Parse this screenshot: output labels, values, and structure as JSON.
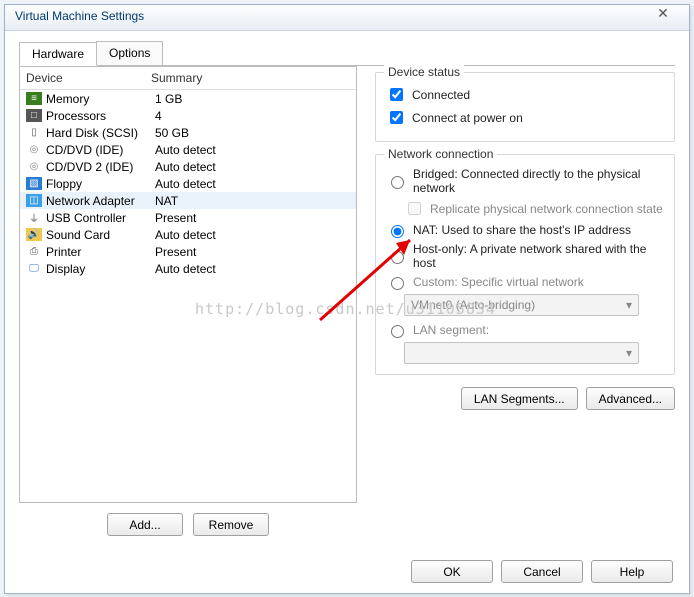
{
  "title": "Virtual Machine Settings",
  "tabs": {
    "hardware": "Hardware",
    "options": "Options"
  },
  "table": {
    "h1": "Device",
    "h2": "Summary"
  },
  "devices": {
    "mem": {
      "name": "Memory",
      "summary": "1 GB"
    },
    "cpu": {
      "name": "Processors",
      "summary": "4"
    },
    "hd": {
      "name": "Hard Disk (SCSI)",
      "summary": "50 GB"
    },
    "cd1": {
      "name": "CD/DVD (IDE)",
      "summary": "Auto detect"
    },
    "cd2": {
      "name": "CD/DVD 2 (IDE)",
      "summary": "Auto detect"
    },
    "flop": {
      "name": "Floppy",
      "summary": "Auto detect"
    },
    "net": {
      "name": "Network Adapter",
      "summary": "NAT"
    },
    "usb": {
      "name": "USB Controller",
      "summary": "Present"
    },
    "snd": {
      "name": "Sound Card",
      "summary": "Auto detect"
    },
    "prn": {
      "name": "Printer",
      "summary": "Present"
    },
    "disp": {
      "name": "Display",
      "summary": "Auto detect"
    }
  },
  "buttons": {
    "add": "Add...",
    "remove": "Remove",
    "ok": "OK",
    "cancel": "Cancel",
    "help": "Help",
    "lanseg": "LAN Segments...",
    "adv": "Advanced..."
  },
  "status": {
    "title": "Device status",
    "connected": "Connected",
    "poweron": "Connect at power on"
  },
  "netconn": {
    "title": "Network connection",
    "bridged": "Bridged: Connected directly to the physical network",
    "replicate": "Replicate physical network connection state",
    "nat": "NAT: Used to share the host's IP address",
    "hostonly": "Host-only: A private network shared with the host",
    "custom": "Custom: Specific virtual network",
    "vmnet": "VMnet0 (Auto-bridging)",
    "lanseg": "LAN segment:"
  },
  "watermark": "http://blog.csdn.net/u31105834"
}
